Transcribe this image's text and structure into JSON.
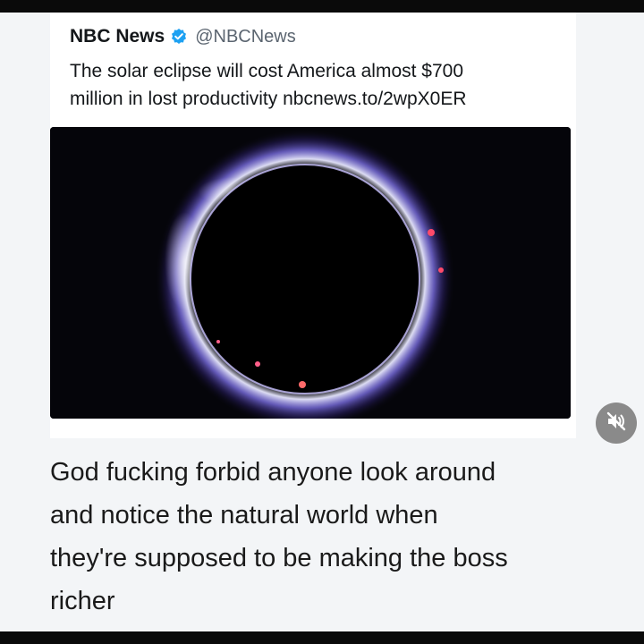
{
  "tweet": {
    "author_name": "NBC News",
    "author_handle": "@NBCNews",
    "verified_icon": "verified-check-icon",
    "text": "The solar eclipse will cost America almost $700\nmillion in lost productivity nbcnews.to/2wpX0ER",
    "image": "solar-eclipse-photo"
  },
  "caption": {
    "text": "God fucking forbid anyone look around\nand notice the natural world when\nthey're supposed to be making the boss\nricher"
  },
  "controls": {
    "mute_icon": "speaker-muted-icon"
  },
  "colors": {
    "verified_blue": "#1da1f2",
    "card_background": "#f3f5f7",
    "frame_black": "#0a0a0a"
  }
}
